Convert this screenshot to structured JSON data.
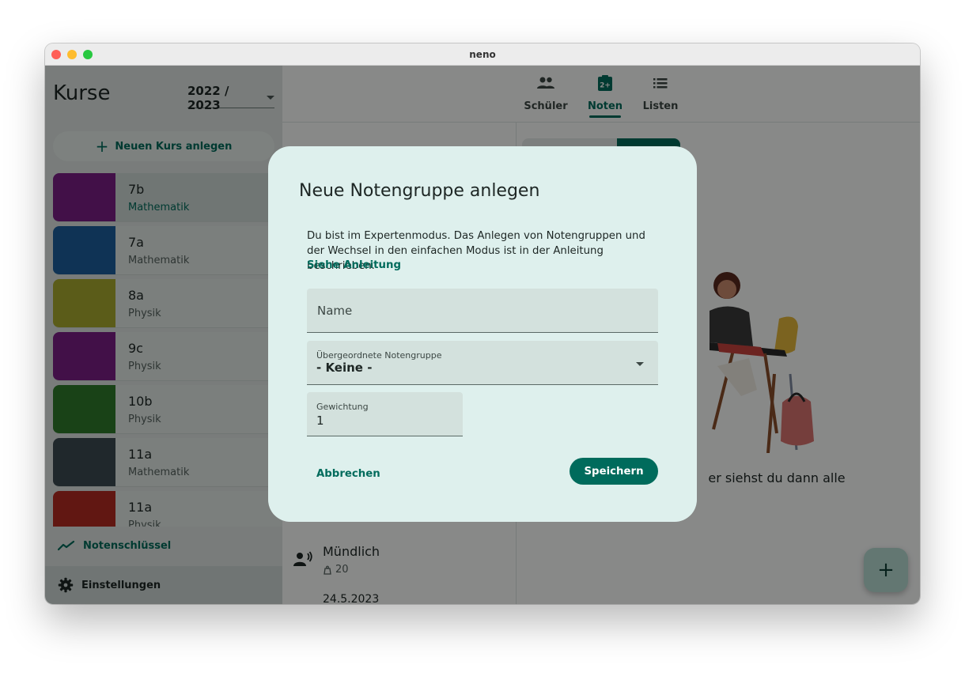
{
  "window": {
    "title": "neno"
  },
  "sidebar": {
    "title": "Kurse",
    "year": "2022 / 2023",
    "new_course_label": "Neuen Kurs anlegen",
    "courses": [
      {
        "name": "7b",
        "subject": "Mathematik",
        "color": "#7a1f86",
        "selected": true
      },
      {
        "name": "7a",
        "subject": "Mathematik",
        "color": "#1c5f9e"
      },
      {
        "name": "8a",
        "subject": "Physik",
        "color": "#a8ab2f"
      },
      {
        "name": "9c",
        "subject": "Physik",
        "color": "#7a1f86"
      },
      {
        "name": "10b",
        "subject": "Physik",
        "color": "#2f7a2c"
      },
      {
        "name": "11a",
        "subject": "Mathematik",
        "color": "#3c4a52"
      },
      {
        "name": "11a",
        "subject": "Physik",
        "color": "#b42b22"
      }
    ],
    "notenschluessel_label": "Notenschlüssel",
    "settings_label": "Einstellungen"
  },
  "tabs": [
    {
      "label": "Schüler",
      "icon": "people-icon"
    },
    {
      "label": "Noten",
      "icon": "grade-clipboard-icon",
      "active": true
    },
    {
      "label": "Listen",
      "icon": "list-icon"
    }
  ],
  "entry": {
    "title": "Mündlich",
    "count": "20",
    "date": "24.5.2023"
  },
  "empty_state_text": "er siehst du dann alle",
  "fab_label": "+",
  "dialog": {
    "title": "Neue Notengruppe anlegen",
    "text": "Du bist im Expertenmodus. Das Anlegen von Notengruppen und der Wechsel in den einfachen Modus ist in der Anleitung beschrieben.",
    "link": "Siehe Anleitung",
    "name_placeholder": "Name",
    "parent_label": "Übergeordnete Notengruppe",
    "parent_value": "- Keine -",
    "weight_label": "Gewichtung",
    "weight_value": "1",
    "cancel_label": "Abbrechen",
    "save_label": "Speichern"
  },
  "colors": {
    "accent": "#006b5c",
    "dialog_bg": "#def0ed"
  }
}
